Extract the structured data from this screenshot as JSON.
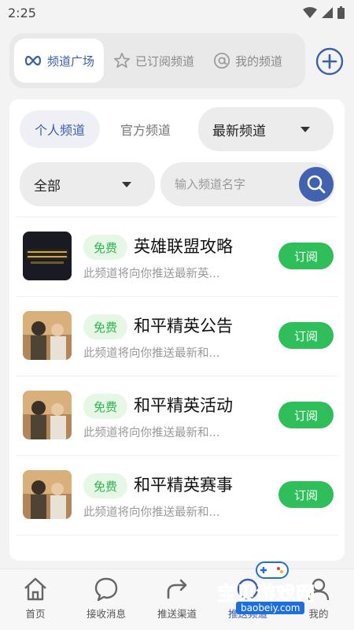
{
  "status_bar": {
    "time": "2:25"
  },
  "top_tabs": [
    {
      "label": "频道广场",
      "icon": "infinity-icon"
    },
    {
      "label": "已订阅频道",
      "icon": "star-icon"
    },
    {
      "label": "我的频道",
      "icon": "at-icon"
    }
  ],
  "filters": {
    "personal": "个人频道",
    "official": "官方频道",
    "sort": "最新频道",
    "category": "全部"
  },
  "search": {
    "placeholder": "输入频道名字"
  },
  "channels": [
    {
      "badge": "免费",
      "title": "英雄联盟攻略",
      "desc": "此频道将向你推送最新英...",
      "button": "订阅"
    },
    {
      "badge": "免费",
      "title": "和平精英公告",
      "desc": "此频道将向你推送最新和...",
      "button": "订阅"
    },
    {
      "badge": "免费",
      "title": "和平精英活动",
      "desc": "此频道将向你推送最新和...",
      "button": "订阅"
    },
    {
      "badge": "免费",
      "title": "和平精英赛事",
      "desc": "此频道将向你推送最新和...",
      "button": "订阅"
    }
  ],
  "bottom_nav": [
    {
      "label": "首页",
      "icon": "home-icon"
    },
    {
      "label": "接收消息",
      "icon": "chat-icon"
    },
    {
      "label": "推送渠道",
      "icon": "share-icon"
    },
    {
      "label": "推送频道",
      "icon": "channel-icon"
    },
    {
      "label": "我的",
      "icon": "user-icon"
    }
  ],
  "watermark": {
    "text": "宝贝游戏网",
    "url": "baobeiy.com"
  },
  "colors": {
    "accent": "#3b5fae",
    "green": "#2fbf5a",
    "badge_bg": "#e6f7e6"
  }
}
